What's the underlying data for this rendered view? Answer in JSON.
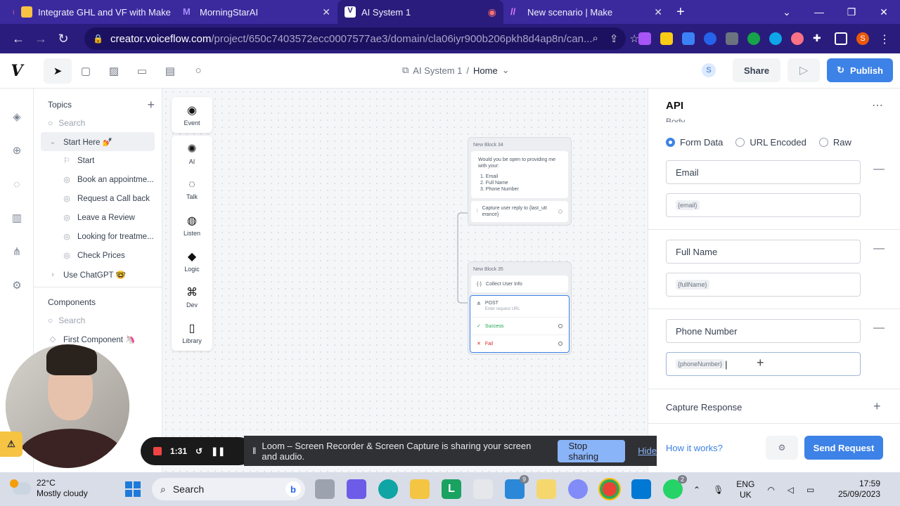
{
  "browser": {
    "tabs": [
      {
        "title": "Integrate GHL and VF with Make",
        "color": "#f6c343"
      },
      {
        "title": "MorningStarAI",
        "color": "#8b5cf6"
      },
      {
        "title": "AI System 1",
        "color": "#ffffff"
      },
      {
        "title": "New scenario | Make",
        "color": "#c026d3"
      }
    ],
    "url_host": "creator.voiceflow.com",
    "url_path": "/project/650c7403572ecc0007577ae3/domain/cla06iyr900b206pkh8d4ap8n/can..."
  },
  "header": {
    "project": "AI System 1",
    "separator": "/",
    "page": "Home",
    "avatar_initial": "S",
    "share_label": "Share",
    "publish_label": "Publish"
  },
  "topics": {
    "heading": "Topics",
    "search_placeholder": "Search",
    "start_here": "Start Here 💅",
    "items": [
      "Start",
      "Book an appointme...",
      "Request a Call back",
      "Leave a Review",
      "Looking for treatme...",
      "Check Prices"
    ],
    "use_chatgpt": "Use ChatGPT 🤓"
  },
  "components": {
    "heading": "Components",
    "search_placeholder": "Search",
    "first": "First Component 🦄"
  },
  "steps": [
    "Event",
    "AI",
    "Talk",
    "Listen",
    "Logic",
    "Dev",
    "Library"
  ],
  "canvas": {
    "block34": {
      "title": "New Block 34",
      "message_line1": "Would you be open to providing me",
      "message_line2": "with your:",
      "list": [
        "1. Email",
        "2. Full Name",
        "3. Phone Number"
      ],
      "capture_line1": "Capture user reply to {last_utt",
      "capture_line2": "erance}"
    },
    "block35": {
      "title": "New Block 35",
      "collect": "Collect User Info",
      "api_method": "POST",
      "api_hint": "Enter request URL",
      "success": "Success",
      "fail": "Fail"
    }
  },
  "api_panel": {
    "title": "API",
    "body_label": "Body",
    "body_types": [
      "Form Data",
      "URL Encoded",
      "Raw"
    ],
    "selected_type": "Form Data",
    "fields": [
      {
        "key": "Email",
        "value": "{email}"
      },
      {
        "key": "Full Name",
        "value": "{fullName}"
      },
      {
        "key": "Phone Number",
        "value": "{phoneNumber}"
      }
    ],
    "capture_response": "Capture Response",
    "how_it_works": "How it works?",
    "send_request": "Send Request"
  },
  "loom": {
    "timer": "1:31",
    "message": "Loom – Screen Recorder & Screen Capture is sharing your screen and audio.",
    "stop_sharing": "Stop sharing",
    "hide": "Hide"
  },
  "taskbar": {
    "temperature": "22°C",
    "weather": "Mostly cloudy",
    "search": "Search",
    "lang_line1": "ENG",
    "lang_line2": "UK",
    "time": "17:59",
    "date": "25/09/2023",
    "mail_badge": "9",
    "whatsapp_badge": "2"
  },
  "colors": {
    "accent": "#3d82e6",
    "browser_bg": "#3b2a9e"
  }
}
